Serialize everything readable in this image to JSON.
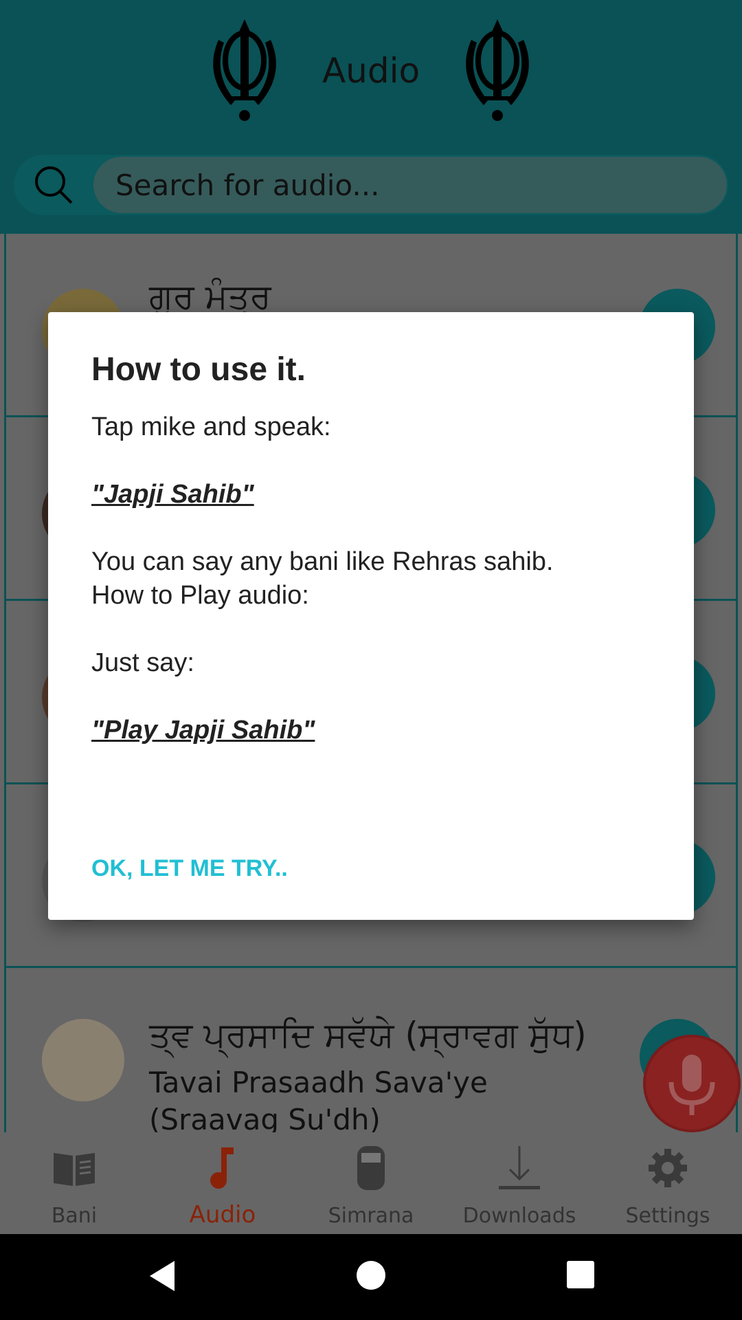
{
  "header": {
    "title": "Audio",
    "icon": "khanda-icon"
  },
  "search": {
    "placeholder": "Search for audio..."
  },
  "list": {
    "items": [
      {
        "punjabi": "ਗੁਰ ਮੰਤ੍ਰ",
        "english": ""
      },
      {
        "punjabi": "",
        "english": ""
      },
      {
        "punjabi": "",
        "english": ""
      },
      {
        "punjabi": "",
        "english": ""
      },
      {
        "punjabi": "ਤ੍ਵ ਪ੍ਰਸਾਦਿ ਸਵੱਯੇ (ਸ੍ਰਾਵਗ ਸੁੱਧ)",
        "english": "Tavai Prasaadh Sava'ye (Sraavag Su'dh)"
      }
    ]
  },
  "dialog": {
    "title": "How to use it.",
    "line1": "Tap mike and speak:",
    "example1": "\"Japji Sahib\"",
    "line2": "You can say any bani like Rehras sahib.",
    "line3": "How to Play audio:",
    "line4": "Just say:",
    "example2": "\"Play Japji Sahib\"",
    "button": "OK, LET ME TRY.."
  },
  "nav": {
    "items": [
      {
        "label": "Bani",
        "icon": "book-icon"
      },
      {
        "label": "Audio",
        "icon": "music-note-icon",
        "active": true
      },
      {
        "label": "Simrana",
        "icon": "counter-icon"
      },
      {
        "label": "Downloads",
        "icon": "download-icon"
      },
      {
        "label": "Settings",
        "icon": "gear-icon"
      }
    ]
  },
  "colors": {
    "header": "#0a5256",
    "accent": "#21bfd3",
    "active_tab": "#8a2208",
    "mic": "#8a2222"
  }
}
